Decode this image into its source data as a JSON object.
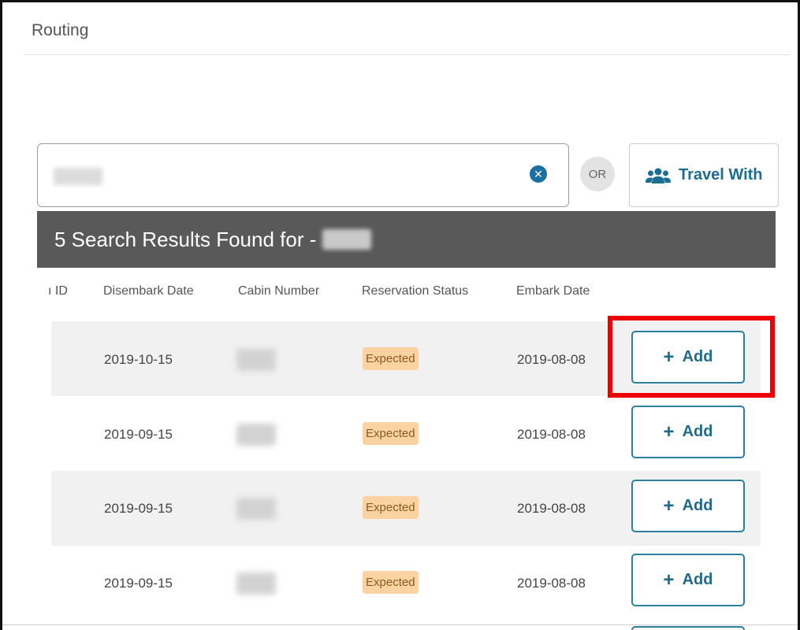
{
  "panel": {
    "title": "Routing"
  },
  "search": {
    "value": "",
    "clear_icon": "times-circle-icon"
  },
  "or_label": "OR",
  "travel_with": {
    "label": "Travel With",
    "icon": "users-icon"
  },
  "results": {
    "heading": "5 Search Results Found for -"
  },
  "columns": [
    "ı ID",
    "Disembark Date",
    "Cabin Number",
    "Reservation Status",
    "Embark Date"
  ],
  "rows": [
    {
      "disembark_date": "2019-10-15",
      "status": "Expected",
      "embark_date": "2019-08-08",
      "action": "Add"
    },
    {
      "disembark_date": "2019-09-15",
      "status": "Expected",
      "embark_date": "2019-08-08",
      "action": "Add"
    },
    {
      "disembark_date": "2019-09-15",
      "status": "Expected",
      "embark_date": "2019-08-08",
      "action": "Add"
    },
    {
      "disembark_date": "2019-09-15",
      "status": "Expected",
      "embark_date": "2019-08-08",
      "action": "Add"
    }
  ],
  "colors": {
    "accent": "#1f6a8c",
    "header_bg": "#595959",
    "status_bg": "#fbd2a1",
    "highlight": "#ee0000"
  }
}
